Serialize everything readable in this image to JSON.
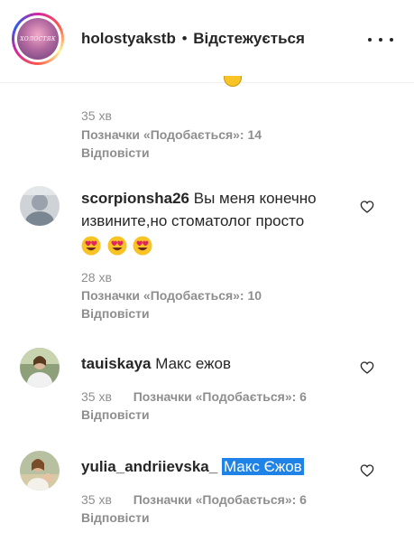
{
  "header": {
    "username": "holostyakstb",
    "separator": "•",
    "follow_status": "Відстежується",
    "avatar_logo_text": "ХОЛОСТЯК"
  },
  "comments": [
    {
      "time": "35 хв",
      "likes": "Позначки «Подобається»: 14",
      "reply": "Відповісти"
    },
    {
      "username": "scorpionsha26",
      "text": "Вы меня конечно извините,но стоматолог просто",
      "emojis": [
        "heart-eyes-emoji",
        "heart-eyes-emoji",
        "heart-eyes-emoji"
      ],
      "time": "28 хв",
      "likes": "Позначки «Подобається»: 10",
      "reply": "Відповісти"
    },
    {
      "username": "tauiskaya",
      "text": "Макс ежов",
      "time": "35 хв",
      "likes": "Позначки «Подобається»: 6",
      "reply": "Відповісти"
    },
    {
      "username": "yulia_andriievska_",
      "text": "Макс Єжов",
      "time": "35 хв",
      "likes": "Позначки «Подобається»: 6",
      "reply": "Відповісти"
    }
  ],
  "colors": {
    "text": "#262626",
    "secondary": "#8e8e8e",
    "selection": "#1e82e6",
    "emoji": "#f7c325",
    "heart_eyes": "#e0245e"
  }
}
